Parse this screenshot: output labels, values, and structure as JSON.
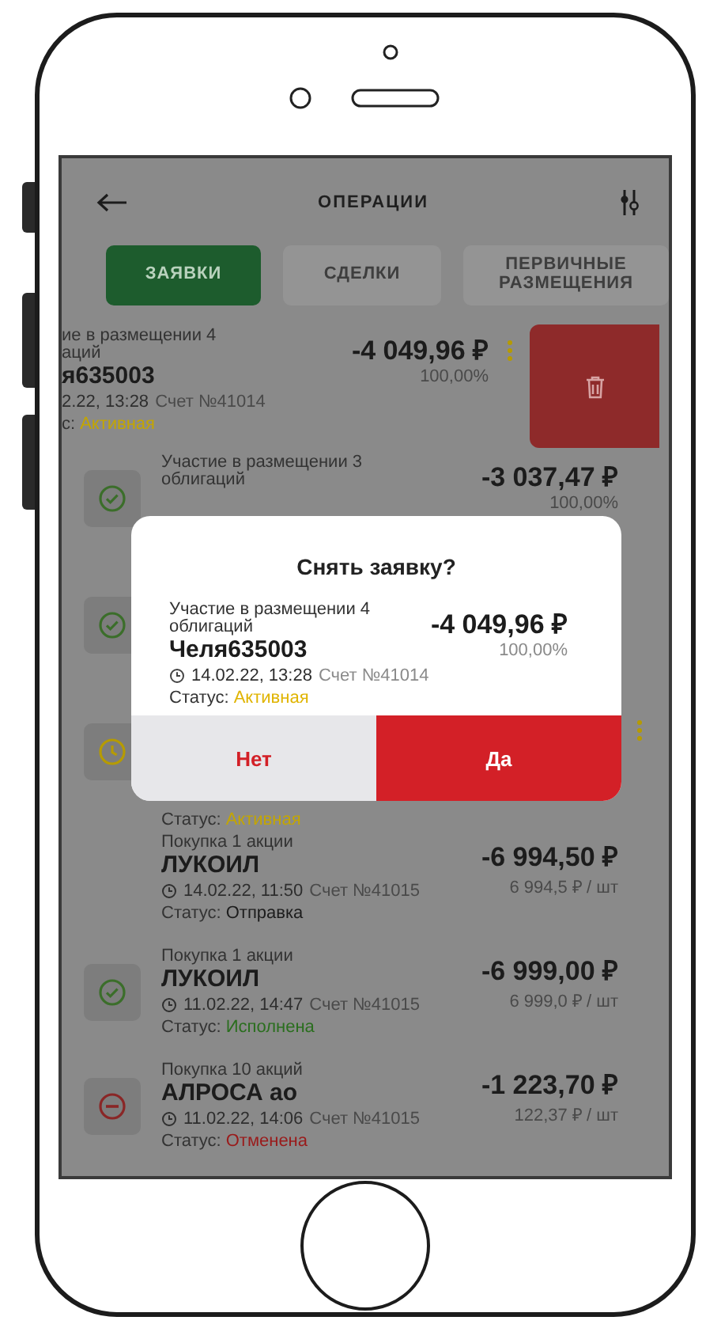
{
  "header": {
    "title": "ОПЕРАЦИИ"
  },
  "tabs": [
    {
      "label": "ЗАЯВКИ",
      "selected": true
    },
    {
      "label": "СДЕЛКИ",
      "selected": false
    },
    {
      "label": "ПЕРВИЧНЫЕ РАЗМЕЩЕНИЯ",
      "selected": false
    }
  ],
  "orders": [
    {
      "swiped": true,
      "title": "ие в размещении 4\nаций",
      "name": "я635003",
      "time": "2.22, 13:28",
      "account": "Счет №41014",
      "status": {
        "label": "с:",
        "value": "Активная",
        "color": "#c4a600"
      },
      "amount": "-4 049,96 ₽",
      "note": "100,00%",
      "menu": true
    },
    {
      "kind": "done",
      "title": "Участие в размещении 3\nоблигаций",
      "amount": "-3 037,47 ₽",
      "note": "100,00%"
    },
    {
      "kind": "done"
    },
    {
      "kind": "pending",
      "status": {
        "label": "Статус:",
        "value": "Активная",
        "color": "#c4a600"
      },
      "menu": true
    },
    {
      "title": "Покупка 1 акции",
      "name": "ЛУКОИЛ",
      "clock": true,
      "time": "14.02.22, 11:50",
      "account": "Счет №41015",
      "status": {
        "label": "Статус:",
        "value": "Отправка",
        "color": "#1c1c1c"
      },
      "amount": "-6 994,50 ₽",
      "note": "6 994,5 ₽ / шт"
    },
    {
      "kind": "done",
      "title": "Покупка 1 акции",
      "name": "ЛУКОИЛ",
      "clock": true,
      "time": "11.02.22, 14:47",
      "account": "Счет №41015",
      "status": {
        "label": "Статус:",
        "value": "Исполнена",
        "color": "#2a6e1e"
      },
      "amount": "-6 999,00 ₽",
      "note": "6 999,0 ₽ / шт"
    },
    {
      "kind": "cancelled",
      "title": "Покупка 10 акций",
      "name": "АЛРОСА ао",
      "clock": true,
      "time": "11.02.22, 14:06",
      "account": "Счет №41015",
      "status": {
        "label": "Статус:",
        "value": "Отменена",
        "color": "#9a1a1a"
      },
      "amount": "-1 223,70 ₽",
      "note": "122,37 ₽ / шт"
    }
  ],
  "dialog": {
    "title": "Снять заявку?",
    "order": {
      "title": "Участие в размещении 4\nоблигаций",
      "name": "Челя635003",
      "time": "14.02.22, 13:28",
      "account": "Счет №41014",
      "status": {
        "label": "Статус:",
        "value": "Активная",
        "color": "#e0b400"
      },
      "amount": "-4 049,96 ₽",
      "note": "100,00%"
    },
    "buttons": [
      {
        "label": "Нет",
        "kind": "cancel"
      },
      {
        "label": "Да",
        "kind": "confirm"
      }
    ]
  }
}
